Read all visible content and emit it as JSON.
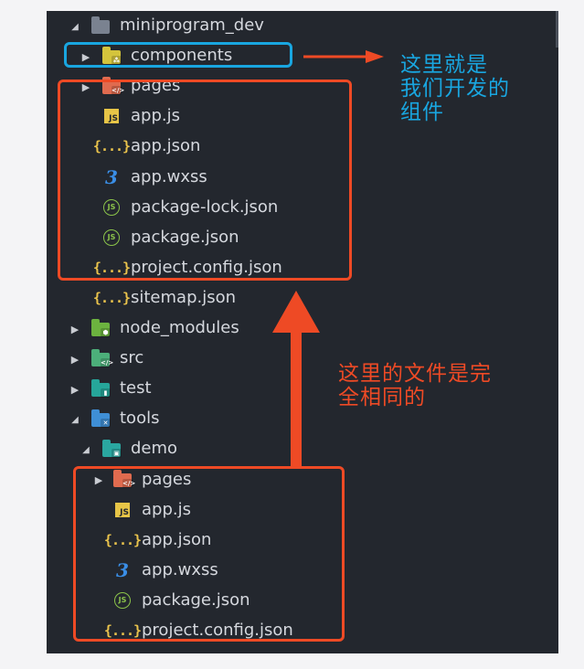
{
  "tree": {
    "items": [
      {
        "label": "miniprogram_dev",
        "icon": "folder-open-icon",
        "folder_color": "#7a8290",
        "badge": "",
        "expanded": true
      },
      {
        "label": "components",
        "icon": "components-folder-icon",
        "folder_color": "#d4c43c",
        "badge": "⁂",
        "expanded": false
      },
      {
        "label": "pages",
        "icon": "pages-folder-icon",
        "folder_color": "#e06b4f",
        "badge": "</>",
        "expanded": false
      },
      {
        "label": "app.js",
        "icon": "js-file-icon",
        "glyph": "JS"
      },
      {
        "label": "app.json",
        "icon": "json-file-icon",
        "glyph": "{...}"
      },
      {
        "label": "app.wxss",
        "icon": "css-file-icon",
        "glyph": "3"
      },
      {
        "label": "package-lock.json",
        "icon": "node-file-icon",
        "glyph": "JS"
      },
      {
        "label": "package.json",
        "icon": "node-file-icon",
        "glyph": "JS"
      },
      {
        "label": "project.config.json",
        "icon": "json-file-icon",
        "glyph": "{...}"
      },
      {
        "label": "sitemap.json",
        "icon": "json-file-icon",
        "glyph": "{...}"
      },
      {
        "label": "node_modules",
        "icon": "node-modules-folder-icon",
        "folder_color": "#6cb33f",
        "badge": "⬢",
        "expanded": false
      },
      {
        "label": "src",
        "icon": "src-folder-icon",
        "folder_color": "#4caf7a",
        "badge": "</>",
        "expanded": false
      },
      {
        "label": "test",
        "icon": "test-folder-icon",
        "folder_color": "#26a69a",
        "badge": "▮",
        "expanded": false
      },
      {
        "label": "tools",
        "icon": "tools-folder-icon",
        "folder_color": "#3f8fd6",
        "badge": "✕",
        "expanded": true
      },
      {
        "label": "demo",
        "icon": "demo-folder-icon",
        "folder_color": "#2aa7a0",
        "badge": "▣",
        "expanded": true
      },
      {
        "label": "pages",
        "icon": "pages-folder-icon",
        "folder_color": "#e06b4f",
        "badge": "</>",
        "expanded": false
      },
      {
        "label": "app.js",
        "icon": "js-file-icon",
        "glyph": "JS"
      },
      {
        "label": "app.json",
        "icon": "json-file-icon",
        "glyph": "{...}"
      },
      {
        "label": "app.wxss",
        "icon": "css-file-icon",
        "glyph": "3"
      },
      {
        "label": "package.json",
        "icon": "node-file-icon",
        "glyph": "JS"
      },
      {
        "label": "project.config.json",
        "icon": "json-file-icon",
        "glyph": "{...}"
      }
    ]
  },
  "annotations": {
    "components_note": "这里就是\n我们开发的\n组件",
    "same_files_note": "这里的文件是完\n全相同的",
    "box_blue": "#19a6e0",
    "box_red": "#ee4a25"
  }
}
